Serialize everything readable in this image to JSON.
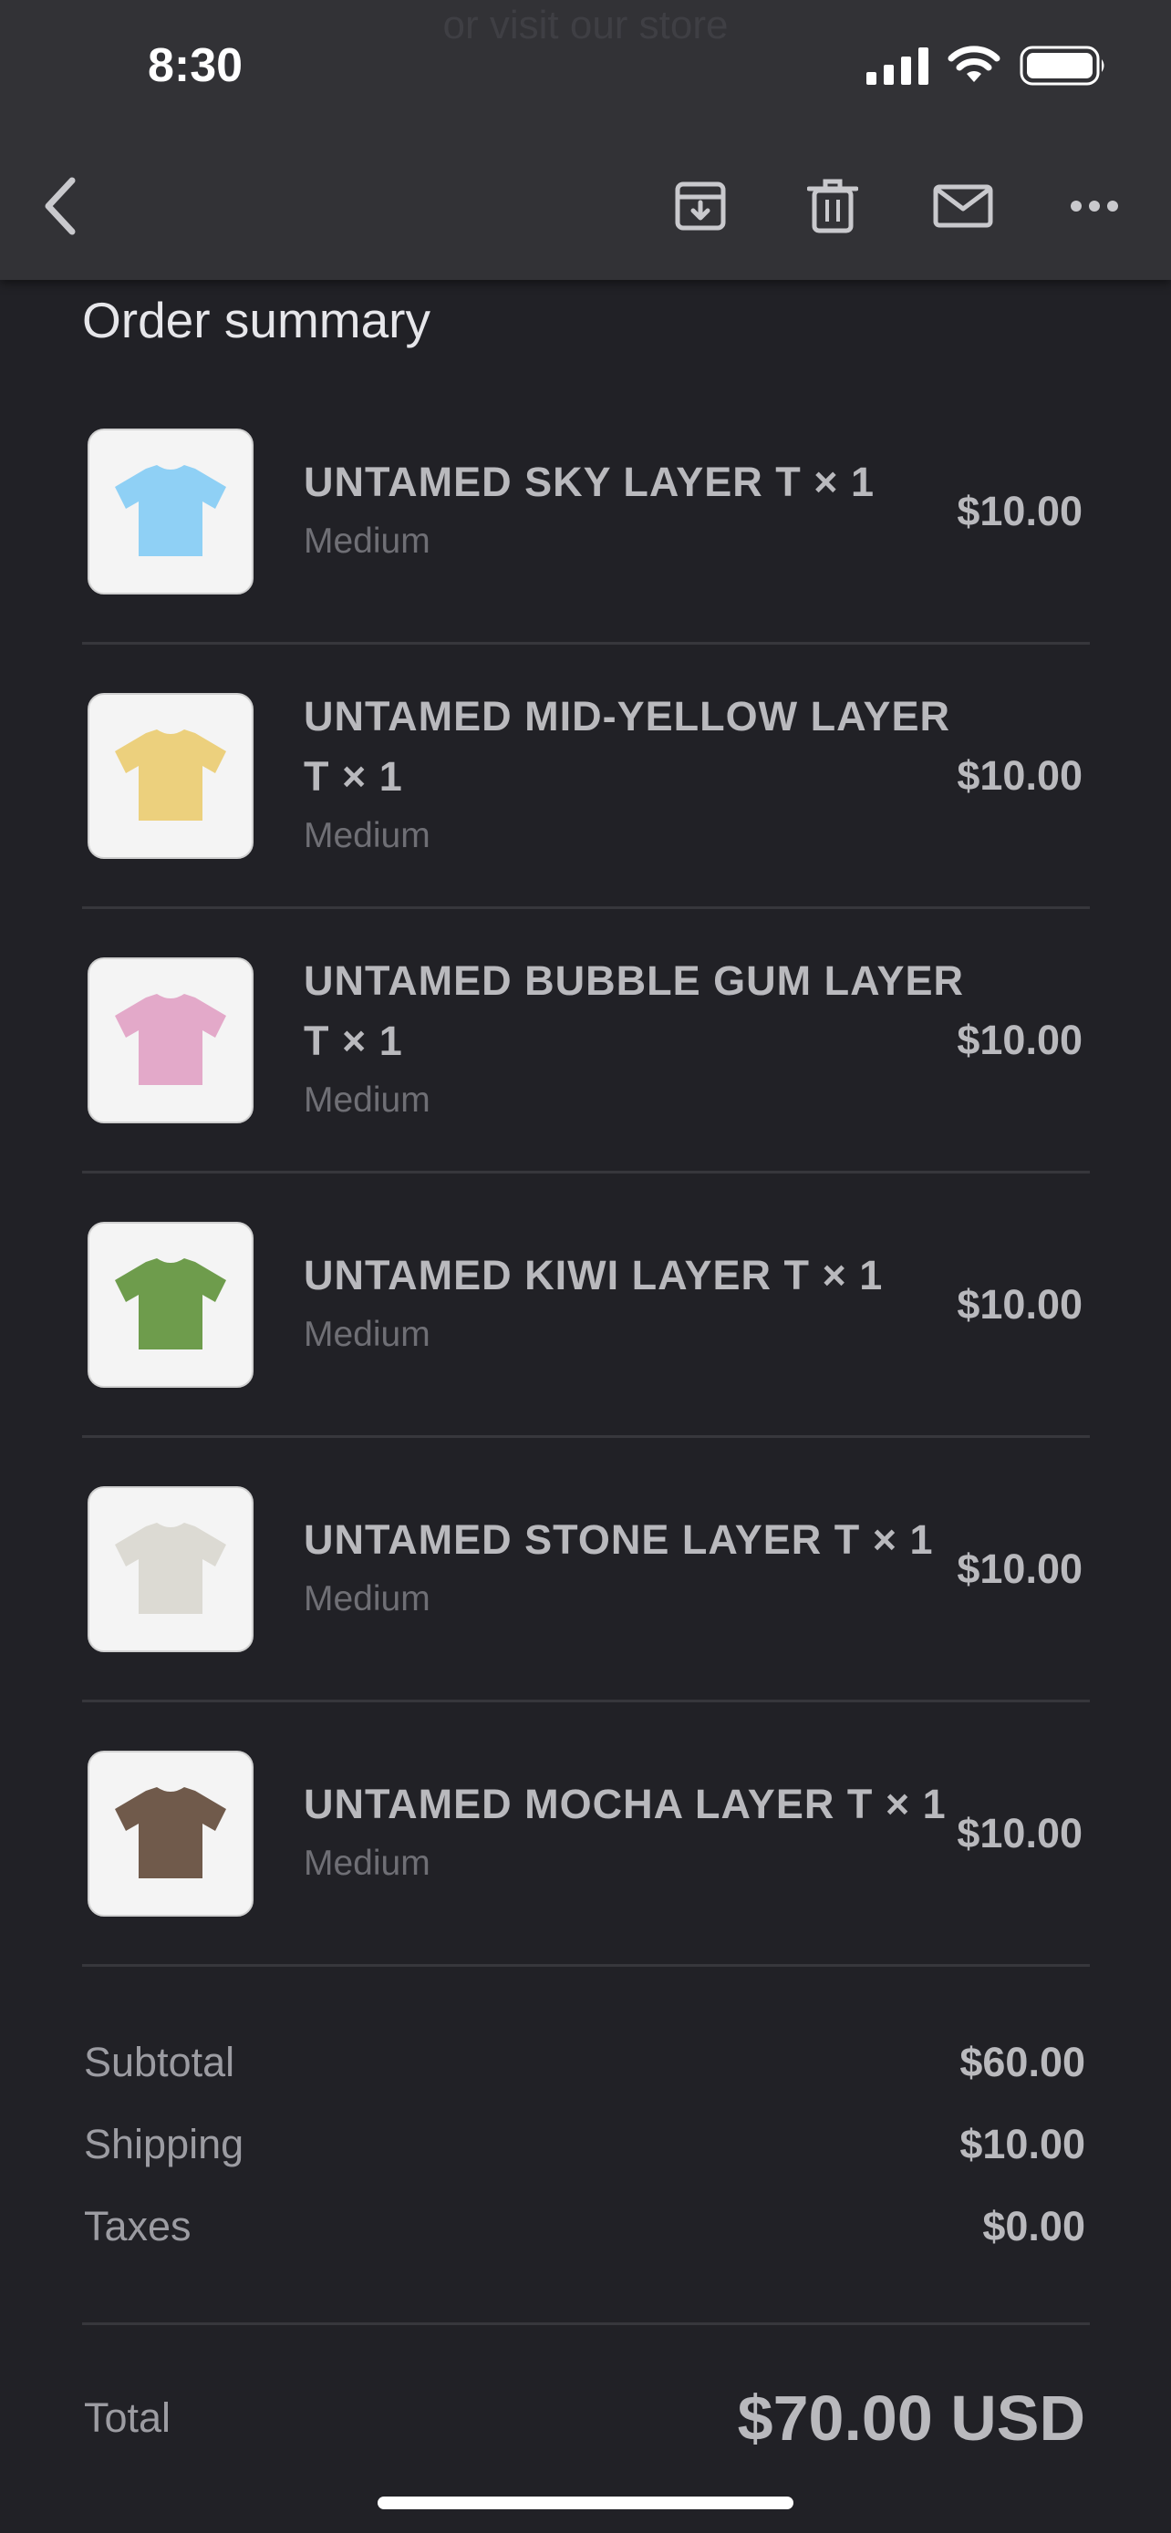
{
  "status_bar": {
    "time": "8:30"
  },
  "ghost_header_text": "or visit our store",
  "toolbar": {
    "back_icon": "chevron-left-icon",
    "actions": [
      "archive-icon",
      "trash-icon",
      "mail-icon",
      "more-icon"
    ]
  },
  "order_summary": {
    "title": "Order summary",
    "items": [
      {
        "title": "UNTAMED SKY LAYER T × 1",
        "variant": "Medium",
        "price": "$10.00",
        "color": "#8fd0f5"
      },
      {
        "title": "UNTAMED MID-YELLOW LAYER T × 1",
        "variant": "Medium",
        "price": "$10.00",
        "color": "#ecd07d"
      },
      {
        "title": "UNTAMED BUBBLE GUM LAYER T × 1",
        "variant": "Medium",
        "price": "$10.00",
        "color": "#e3a9c9"
      },
      {
        "title": "UNTAMED KIWI LAYER T × 1",
        "variant": "Medium",
        "price": "$10.00",
        "color": "#6e9c4c"
      },
      {
        "title": "UNTAMED STONE LAYER T × 1",
        "variant": "Medium",
        "price": "$10.00",
        "color": "#dcdad3"
      },
      {
        "title": "UNTAMED MOCHA LAYER T × 1",
        "variant": "Medium",
        "price": "$10.00",
        "color": "#705a4b"
      }
    ],
    "subtotal_label": "Subtotal",
    "subtotal_value": "$60.00",
    "shipping_label": "Shipping",
    "shipping_value": "$10.00",
    "taxes_label": "Taxes",
    "taxes_value": "$0.00",
    "total_label": "Total",
    "total_value": "$70.00 USD"
  }
}
